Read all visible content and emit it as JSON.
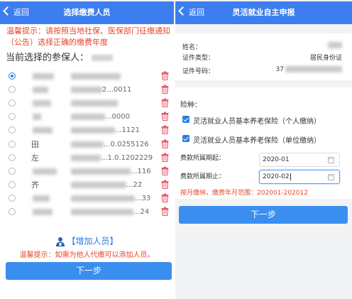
{
  "left": {
    "header": {
      "back_label": "返回",
      "title": "选择缴费人员"
    },
    "warning": "温馨提示：请按照当地社保、医保部门征缴通知（公告）选择正确的缴费年度",
    "current_label": "当前选择的参保人：",
    "persons": [
      {
        "name_tail": "",
        "id_tail": "",
        "selected": true
      },
      {
        "name_tail": "",
        "id_tail": "2...0011",
        "selected": false
      },
      {
        "name_tail": "",
        "id_tail": "",
        "selected": false
      },
      {
        "name_tail": "",
        "id_tail": "...0000",
        "selected": false
      },
      {
        "name_tail": "",
        "id_tail": "...1121",
        "selected": false
      },
      {
        "name_tail": "田",
        "id_tail": "...0.0255126",
        "selected": false
      },
      {
        "name_tail": "左",
        "id_tail": "...1.0.1202229",
        "selected": false
      },
      {
        "name_tail": "",
        "id_tail": "...116",
        "selected": false
      },
      {
        "name_tail": "齐",
        "id_tail": "...22",
        "selected": false
      },
      {
        "name_tail": "",
        "id_tail": "...33",
        "selected": false
      },
      {
        "name_tail": "",
        "id_tail": "...24",
        "selected": false
      }
    ],
    "add_label": "【增加人员】",
    "add_hint": "温馨提示：如需为他人代缴可以添加人员。",
    "next_label": "下一步"
  },
  "right": {
    "header": {
      "back_label": "返回",
      "title": "灵活就业自主申报"
    },
    "info": {
      "name_label": "姓名：",
      "cert_type_label": "证件类型：",
      "cert_type_value": "居民身份证",
      "cert_no_label": "证件号码：",
      "cert_no_value": "37"
    },
    "insurance_label": "险种：",
    "insurances": [
      {
        "label": "灵活就业人员基本养老保险（个人缴纳）",
        "checked": true
      },
      {
        "label": "灵活就业人员基本养老保险（单位缴纳）",
        "checked": true
      }
    ],
    "period_start_label": "费款所属期起：",
    "period_start_value": "2020-01",
    "period_end_label": "费款所属期止：",
    "period_end_value": "2020-02",
    "range_text": "按月缴纳，缴费年月范围：202001-202012",
    "next_label": "下一步"
  },
  "colors": {
    "primary": "#3c7ef0",
    "button": "#3a8ef0",
    "warning": "#e8462b",
    "link": "#2c7be5",
    "trash": "#e85566"
  }
}
